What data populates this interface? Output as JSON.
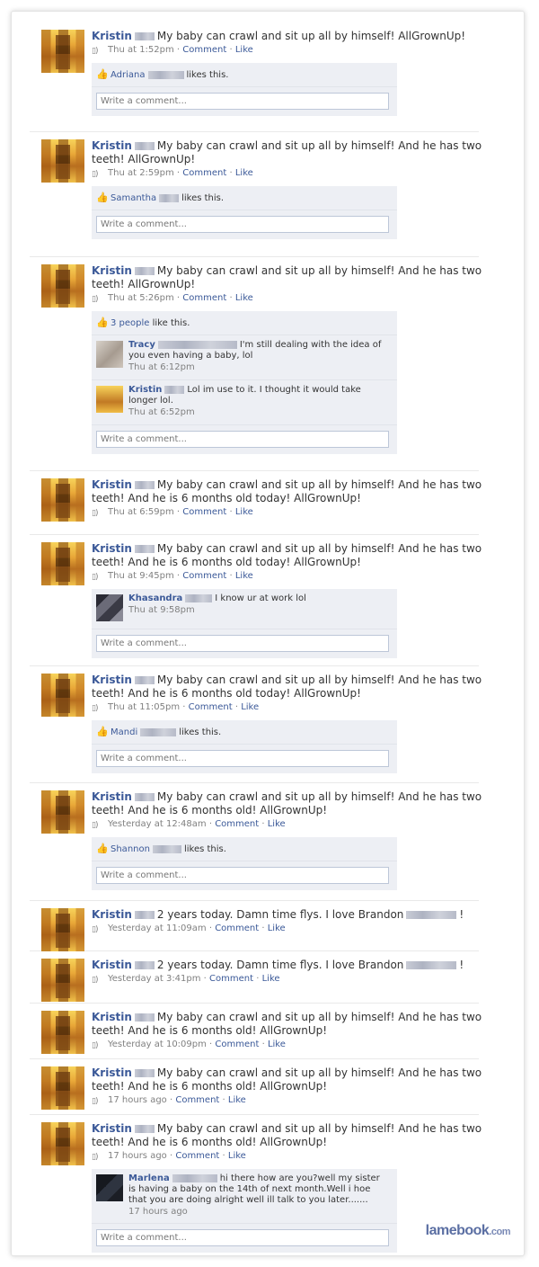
{
  "watermark": {
    "main": "lamebook",
    "suffix": ".com"
  },
  "comment_placeholder": "Write a comment...",
  "actions": {
    "comment": "Comment",
    "like": "Like",
    "sep": " · "
  },
  "stories": [
    {
      "name": "Kristin",
      "text": "My baby can crawl and sit up all by himself! AllGrownUp!",
      "time": "Thu at 1:52pm",
      "likes": {
        "name": "Adriana",
        "suffix": "likes this."
      }
    },
    {
      "name": "Kristin",
      "text": "My baby can crawl and sit up all by himself! And he has two teeth! AllGrownUp!",
      "time": "Thu at 2:59pm",
      "likes": {
        "name": "Samantha",
        "suffix": "likes this."
      }
    },
    {
      "name": "Kristin",
      "text": "My baby can crawl and sit up all by himself! And he has two teeth! AllGrownUp!",
      "time": "Thu at 5:26pm",
      "likes": {
        "link": "3 people",
        "suffix": "like this."
      },
      "comments": [
        {
          "name": "Tracy",
          "text": "I'm still dealing with the idea of you even having a baby, lol",
          "time": "Thu at 6:12pm"
        },
        {
          "name": "Kristin",
          "text": "Lol im use to it. I thought it would take longer lol.",
          "time": "Thu at 6:52pm"
        }
      ]
    },
    {
      "name": "Kristin",
      "text": "My baby can crawl and sit up all by himself! And he has two teeth! And he is 6 months old today! AllGrownUp!",
      "time": "Thu at 6:59pm"
    },
    {
      "name": "Kristin",
      "text": "My baby can crawl and sit up all by himself! And he has two teeth! And he is 6 months old today! AllGrownUp!",
      "time": "Thu at 9:45pm",
      "comments": [
        {
          "name": "Khasandra",
          "text": "I know ur at work lol",
          "time": "Thu at 9:58pm"
        }
      ]
    },
    {
      "name": "Kristin",
      "text": "My baby can crawl and sit up all by himself! And he has two teeth! And he is 6 months old today! AllGrownUp!",
      "time": "Thu at 11:05pm",
      "likes": {
        "name": "Mandi",
        "suffix": "likes this."
      }
    },
    {
      "name": "Kristin",
      "text": "My baby can crawl and sit up all by himself! And he has two teeth! And he is 6 months old! AllGrownUp!",
      "time": "Yesterday at 12:48am",
      "likes": {
        "name": "Shannon",
        "suffix": "likes this."
      }
    },
    {
      "name": "Kristin",
      "text": "2 years today. Damn time flys. I love Brandon",
      "text_end": "!",
      "time": "Yesterday at 11:09am"
    },
    {
      "name": "Kristin",
      "text": "2 years today. Damn time flys. I love Brandon",
      "text_end": "!",
      "time": "Yesterday at 3:41pm"
    },
    {
      "name": "Kristin",
      "text": "My baby can crawl and sit up all by himself! And he has two teeth! And he is 6 months old! AllGrownUp!",
      "time": "Yesterday at 10:09pm"
    },
    {
      "name": "Kristin",
      "text": "My baby can crawl and sit up all by himself! And he has two teeth! And he is 6 months old! AllGrownUp!",
      "time": "17 hours ago"
    },
    {
      "name": "Kristin",
      "text": "My baby can crawl and sit up all by himself! And he has two teeth! And he is 6 months old! AllGrownUp!",
      "time": "17 hours ago",
      "comments": [
        {
          "name": "Marlena",
          "text": "hi there how are you?well my sister is having a baby on the 14th of next month.Well i hoe that you are doing alright well ill talk to you later.......",
          "time": "17 hours ago"
        }
      ]
    }
  ]
}
